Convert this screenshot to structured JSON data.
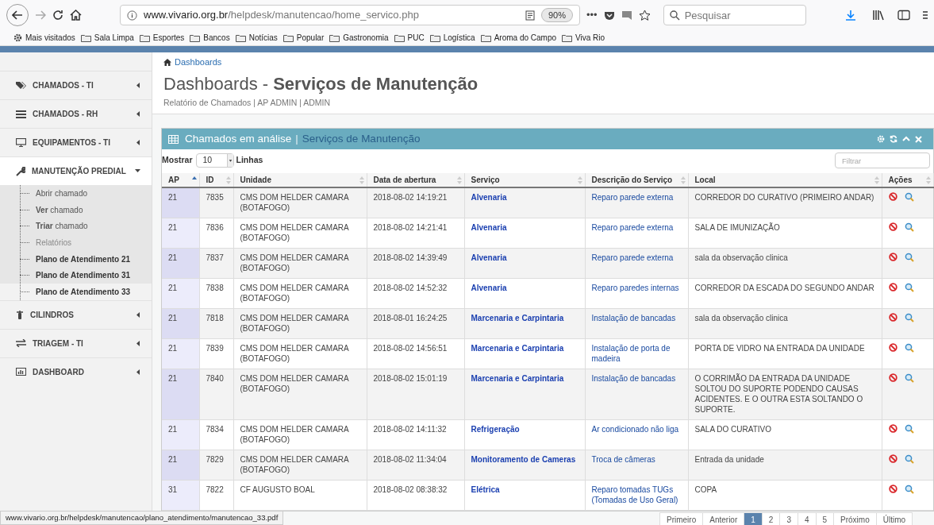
{
  "browser": {
    "url_domain": "www.vivario.org.br",
    "url_path": "/helpdesk/manutencao/home_servico.php",
    "zoom": "90%",
    "more": "•••",
    "search_placeholder": "Pesquisar"
  },
  "bookmarks": [
    {
      "label": "Mais visitados",
      "kind": "gear"
    },
    {
      "label": "Sala Limpa",
      "kind": "folder"
    },
    {
      "label": "Esportes",
      "kind": "folder"
    },
    {
      "label": "Bancos",
      "kind": "folder"
    },
    {
      "label": "Notícias",
      "kind": "folder"
    },
    {
      "label": "Popular",
      "kind": "folder"
    },
    {
      "label": "Gastronomia",
      "kind": "folder"
    },
    {
      "label": "PUC",
      "kind": "folder"
    },
    {
      "label": "Logística",
      "kind": "folder"
    },
    {
      "label": "Aroma do Campo",
      "kind": "folder"
    },
    {
      "label": "Viva Rio",
      "kind": "folder"
    }
  ],
  "sidebar": {
    "items": [
      {
        "label": "CHAMADOS - TI",
        "expanded": false
      },
      {
        "label": "CHAMADOS - RH",
        "expanded": false
      },
      {
        "label": "EQUIPAMENTOS - TI",
        "expanded": false
      },
      {
        "label": "MANUTENÇÃO PREDIAL",
        "expanded": true,
        "children": [
          {
            "label": "Abrir chamado",
            "bold": false,
            "muted": false,
            "selected": false
          },
          {
            "label": "**Ver** chamado",
            "bold": false,
            "muted": false,
            "selected": false
          },
          {
            "label": "**Triar** chamado",
            "bold": false,
            "muted": false,
            "selected": false
          },
          {
            "label": "Relatórios",
            "bold": false,
            "muted": true,
            "selected": false
          },
          {
            "label": "Plano de Atendimento 21",
            "bold": true,
            "muted": false,
            "selected": false
          },
          {
            "label": "Plano de Atendimento 31",
            "bold": true,
            "muted": false,
            "selected": false
          },
          {
            "label": "Plano de Atendimento 33",
            "bold": true,
            "muted": false,
            "selected": true
          }
        ]
      },
      {
        "label": "CILINDROS",
        "expanded": false
      },
      {
        "label": "TRIAGEM - TI",
        "expanded": false
      },
      {
        "label": "DASHBOARD",
        "expanded": false
      }
    ]
  },
  "breadcrumb": "Dashboards",
  "page_title": {
    "light": "Dashboards - ",
    "bold": "Serviços de Manutenção"
  },
  "subtitle": "Relatório de Chamados | AP ADMIN | ADMIN",
  "panel": {
    "title": "Chamados em análise",
    "separator": "|",
    "subtitle": "Serviços de Manutenção"
  },
  "length": {
    "before": "Mostrar",
    "value": "10",
    "after": "Linhas"
  },
  "filter_placeholder": "Filtrar",
  "table": {
    "columns": [
      {
        "label": "AP",
        "sorted": true
      },
      {
        "label": "ID",
        "sorted": false
      },
      {
        "label": "Unidade",
        "sorted": false
      },
      {
        "label": "Data de abertura",
        "sorted": false
      },
      {
        "label": "Serviço",
        "sorted": false
      },
      {
        "label": "Descrição do Serviço",
        "sorted": false
      },
      {
        "label": "Local",
        "sorted": false
      },
      {
        "label": "Ações",
        "sorted": false
      }
    ],
    "rows": [
      {
        "ap": "21",
        "id": "7835",
        "unidade": "CMS DOM HELDER CAMARA (BOTAFOGO)",
        "data": "2018-08-02 14:19:21",
        "servico": "Alvenaria",
        "descricao": "Reparo parede externa",
        "local": "CORREDOR DO CURATIVO (PRIMEIRO ANDAR)"
      },
      {
        "ap": "21",
        "id": "7836",
        "unidade": "CMS DOM HELDER CAMARA (BOTAFOGO)",
        "data": "2018-08-02 14:21:41",
        "servico": "Alvenaria",
        "descricao": "Reparo parede externa",
        "local": "SALA DE IMUNIZAÇÃO"
      },
      {
        "ap": "21",
        "id": "7837",
        "unidade": "CMS DOM HELDER CAMARA (BOTAFOGO)",
        "data": "2018-08-02 14:39:49",
        "servico": "Alvenaria",
        "descricao": "Reparo parede externa",
        "local": "sala da observação clinica"
      },
      {
        "ap": "21",
        "id": "7838",
        "unidade": "CMS DOM HELDER CAMARA (BOTAFOGO)",
        "data": "2018-08-02 14:52:32",
        "servico": "Alvenaria",
        "descricao": "Reparo paredes internas",
        "local": "CORREDOR DA ESCADA DO SEGUNDO ANDAR"
      },
      {
        "ap": "21",
        "id": "7818",
        "unidade": "CMS DOM HELDER CAMARA (BOTAFOGO)",
        "data": "2018-08-01 16:24:25",
        "servico": "Marcenaria e Carpintaria",
        "descricao": "Instalação de bancadas",
        "local": "sala da observação clinica"
      },
      {
        "ap": "21",
        "id": "7839",
        "unidade": "CMS DOM HELDER CAMARA (BOTAFOGO)",
        "data": "2018-08-02 14:56:51",
        "servico": "Marcenaria e Carpintaria",
        "descricao": "Instalação de porta de madeira",
        "local": "PORTA DE VIDRO NA ENTRADA DA UNIDADE"
      },
      {
        "ap": "21",
        "id": "7840",
        "unidade": "CMS DOM HELDER CAMARA (BOTAFOGO)",
        "data": "2018-08-02 15:01:19",
        "servico": "Marcenaria e Carpintaria",
        "descricao": "Instalação de bancadas",
        "local": "O CORRIMÃO DA ENTRADA DA UNIDADE SOLTOU DO SUPORTE PODENDO CAUSAS ACIDENTES. E O OUTRA ESTA SOLTANDO O SUPORTE."
      },
      {
        "ap": "21",
        "id": "7834",
        "unidade": "CMS DOM HELDER CAMARA (BOTAFOGO)",
        "data": "2018-08-02 14:11:32",
        "servico": "Refrigeração",
        "descricao": "Ar condicionado não liga",
        "local": "SALA DO CURATIVO"
      },
      {
        "ap": "21",
        "id": "7829",
        "unidade": "CMS DOM HELDER CAMARA (BOTAFOGO)",
        "data": "2018-08-02 11:34:04",
        "servico": "Monitoramento de Cameras",
        "descricao": "Troca de câmeras",
        "local": "Entrada da unidade"
      },
      {
        "ap": "31",
        "id": "7822",
        "unidade": "CF AUGUSTO BOAL",
        "data": "2018-08-02 08:38:32",
        "servico": "Elétrica",
        "descricao": "Reparo tomadas TUGs (Tomadas de Uso Geral)",
        "local": "COPA"
      }
    ]
  },
  "pagination": [
    {
      "label": "Primeiro",
      "selected": false
    },
    {
      "label": "Anterior",
      "selected": false
    },
    {
      "label": "1",
      "selected": true
    },
    {
      "label": "2",
      "selected": false
    },
    {
      "label": "3",
      "selected": false
    },
    {
      "label": "4",
      "selected": false
    },
    {
      "label": "5",
      "selected": false
    },
    {
      "label": "Próximo",
      "selected": false
    },
    {
      "label": "Último",
      "selected": false
    }
  ],
  "status_url": "www.vivario.org.br/helpdesk/manutencao/plano_atendimento/manutencao_33.pdf"
}
